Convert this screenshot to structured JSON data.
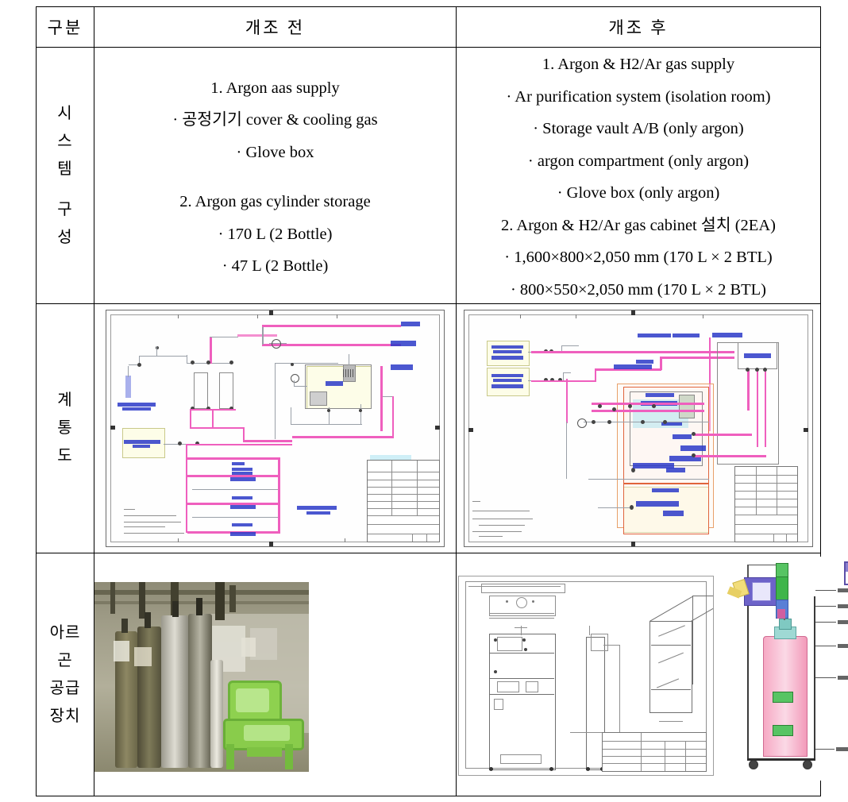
{
  "table": {
    "header": {
      "col1": "구분",
      "col2": "개조 전",
      "col3": "개조 후"
    },
    "rows": [
      {
        "label_lines": [
          "시",
          "스",
          "템",
          "",
          "구",
          "성"
        ],
        "label_plain": "시스템 구성",
        "before": {
          "items": [
            "1.  Argon  aas  supply",
            "·  공정기기  cover  &  cooling  gas",
            "·  Glove  box",
            "2.  Argon  gas  cylinder  storage",
            "·  170  L  (2  Bottle)",
            "·  47  L  (2  Bottle)"
          ]
        },
        "after": {
          "items": [
            "1.  Argon  &  H2/Ar  gas  supply",
            "·  Ar  purification  system  (isolation  room)",
            "·  Storage  vault  A/B  (only  argon)",
            "·  argon  compartment  (only  argon)",
            "·  Glove  box  (only  argon)",
            "2.  Argon  &  H2/Ar  gas  cabinet  설치  (2EA)",
            "·  1,600×800×2,050  mm  (170  L  ×  2  BTL)",
            "·  800×550×2,050  mm  (170  L  ×  2  BTL)"
          ]
        }
      },
      {
        "label_lines": [
          "계",
          "통",
          "도"
        ],
        "label_plain": "계통도",
        "before_figure": "argon-supply-pid-before",
        "after_figure": "argon-supply-pid-after"
      },
      {
        "label_lines": [
          "아르",
          "곤",
          "공급",
          "장치"
        ],
        "label_plain": "아르곤 공급장치",
        "figures": [
          "gas-cylinder-room-photo",
          "gas-cabinet-cad-drawing",
          "gas-cabinet-annotated-illustration"
        ]
      }
    ]
  },
  "colors": {
    "pipe_magenta": "#ef5fbe",
    "pipe_light_pink": "#f48fd0",
    "label_blue": "#2b39c8",
    "cad_gray": "#8f8f8f",
    "callout_purple": "#7a5fbe",
    "callout_yellow": "#fbf3c2",
    "callout_orange": "#f9d7c0",
    "callout_pink": "#f5c6e0",
    "callout_cyan": "#bfe7f4",
    "chair_green": "#7ccc4f",
    "cylinder_pink": "#f7c7d8",
    "frame_black": "#000000"
  }
}
